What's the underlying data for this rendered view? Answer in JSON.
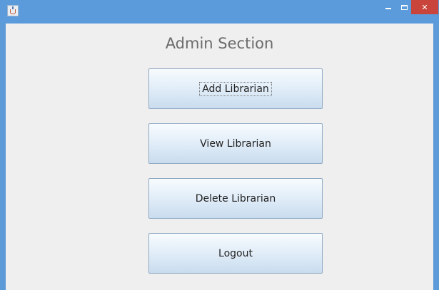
{
  "window": {
    "title": "",
    "close_glyph": "✕"
  },
  "main": {
    "heading": "Admin Section",
    "buttons": {
      "add_librarian": "Add Librarian",
      "view_librarian": "View Librarian",
      "delete_librarian": "Delete Librarian",
      "logout": "Logout"
    }
  },
  "colors": {
    "titlebar": "#5b9bdc",
    "close_button": "#c9443a",
    "background": "#efefef"
  },
  "icons": {
    "app": "java-coffee-cup-icon",
    "minimize": "minimize-icon",
    "maximize": "maximize-icon",
    "close": "close-icon"
  }
}
